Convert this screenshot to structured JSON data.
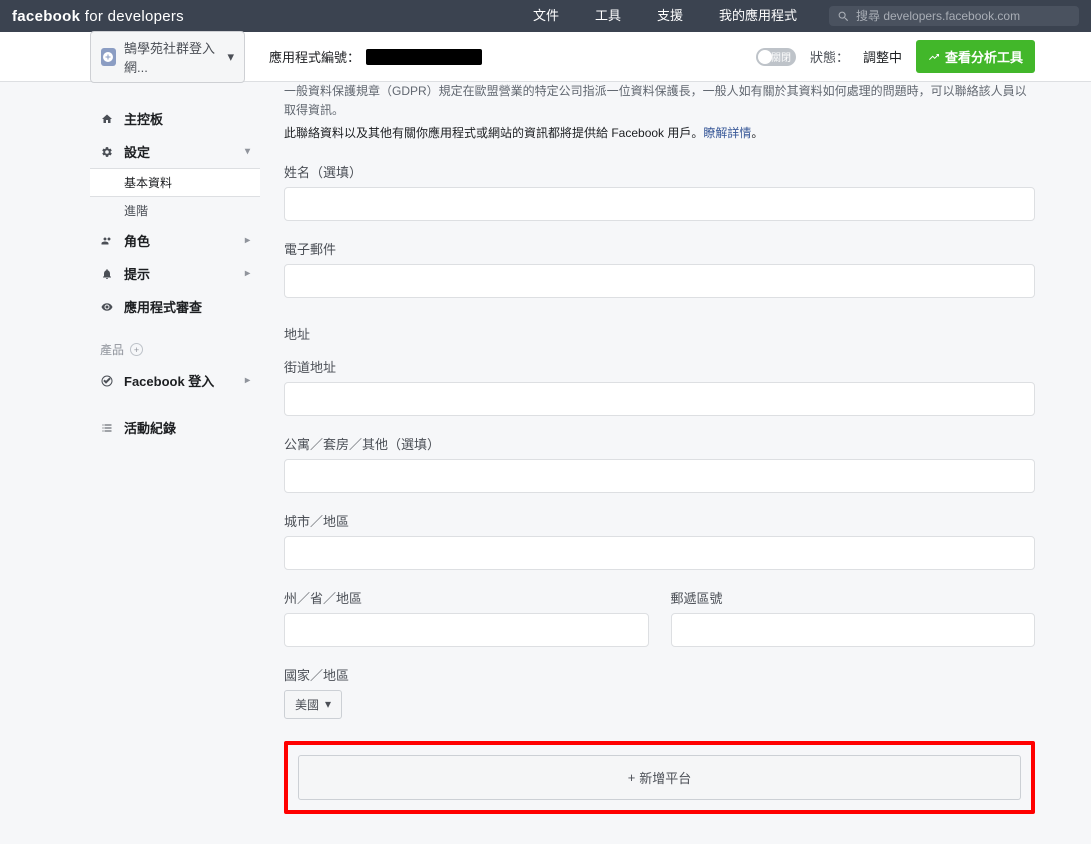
{
  "topbar": {
    "brand_bold": "facebook",
    "brand_rest": " for developers",
    "nav": {
      "docs": "文件",
      "tools": "工具",
      "support": "支援",
      "myapps": "我的應用程式"
    },
    "search_placeholder": "搜尋 developers.facebook.com"
  },
  "subbar": {
    "app_name": "鵠學苑社群登入網...",
    "app_id_label": "應用程式編號：",
    "toggle_label": "關閉",
    "status_label": "狀態：",
    "status_value": "調整中",
    "analytics_btn": "查看分析工具"
  },
  "sidebar": {
    "dashboard": "主控板",
    "settings": "設定",
    "settings_basic": "基本資料",
    "settings_advanced": "進階",
    "roles": "角色",
    "alerts": "提示",
    "review": "應用程式審查",
    "products_label": "產品",
    "fb_login": "Facebook 登入",
    "activity": "活動紀錄"
  },
  "main": {
    "gdpr1": "一般資料保護規章（GDPR）規定在歐盟營業的特定公司指派一位資料保護長，一般人如有關於其資料如何處理的問題時，可以聯絡該人員以取得資訊。",
    "gdpr2_a": "此聯絡資料以及其他有關你應用程式或網站的資訊都將提供給 Facebook 用戶。",
    "gdpr2_link": "瞭解詳情",
    "gdpr2_b": "。",
    "name_label": "姓名（選填）",
    "email_label": "電子郵件",
    "address_section": "地址",
    "street_label": "街道地址",
    "apt_label": "公寓／套房／其他（選填）",
    "city_label": "城市／地區",
    "state_label": "州／省／地區",
    "zip_label": "郵遞區號",
    "country_label": "國家／地區",
    "country_value": "美國",
    "add_platform": "新增平台"
  }
}
